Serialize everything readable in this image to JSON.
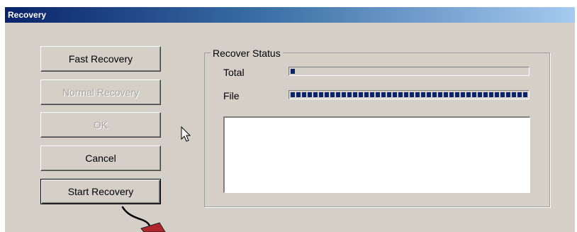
{
  "window": {
    "title": "Recovery"
  },
  "buttons": {
    "fast_recovery": "Fast Recovery",
    "normal_recovery": "Normal Recovery",
    "ok": "OK",
    "cancel": "Cancel",
    "start_recovery": "Start Recovery"
  },
  "status": {
    "group_label": "Recover Status",
    "total_label": "Total",
    "total_progress": 0.02,
    "file_label": "File",
    "file_progress": 1.0,
    "log_text": ""
  },
  "colors": {
    "titlebar_start": "#0a246a",
    "titlebar_end": "#a6caf0",
    "progress_fill": "#0a246a",
    "face": "#d4d0c8"
  },
  "icons": [
    "mouse-cursor-icon"
  ]
}
